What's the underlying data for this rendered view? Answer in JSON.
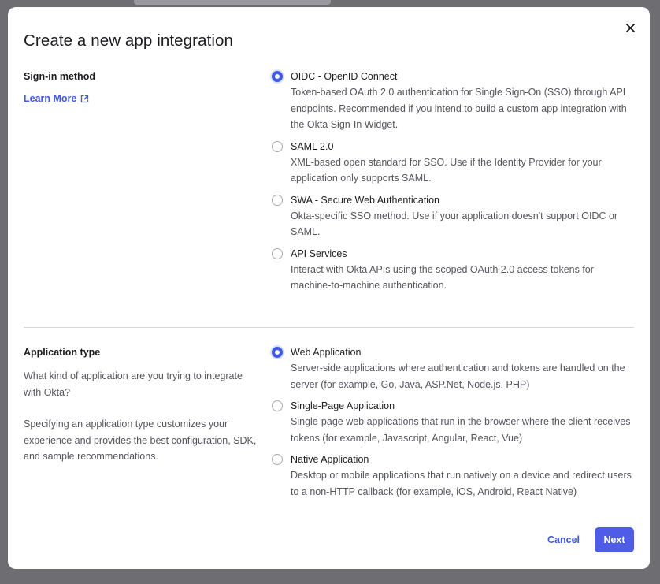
{
  "modal": {
    "title": "Create a new app integration",
    "close_icon": "close-icon"
  },
  "signin": {
    "heading": "Sign-in method",
    "learn_more": "Learn More",
    "learn_more_icon": "external-link-icon",
    "options": [
      {
        "label": "OIDC - OpenID Connect",
        "description": "Token-based OAuth 2.0 authentication for Single Sign-On (SSO) through API endpoints. Recommended if you intend to build a custom app integration with the Okta Sign-In Widget.",
        "selected": true
      },
      {
        "label": "SAML 2.0",
        "description": "XML-based open standard for SSO. Use if the Identity Provider for your application only supports SAML.",
        "selected": false
      },
      {
        "label": "SWA - Secure Web Authentication",
        "description": "Okta-specific SSO method. Use if your application doesn't support OIDC or SAML.",
        "selected": false
      },
      {
        "label": "API Services",
        "description": "Interact with Okta APIs using the scoped OAuth 2.0 access tokens for machine-to-machine authentication.",
        "selected": false
      }
    ]
  },
  "apptype": {
    "heading": "Application type",
    "desc1": "What kind of application are you trying to integrate with Okta?",
    "desc2": "Specifying an application type customizes your experience and provides the best configuration, SDK, and sample recommendations.",
    "options": [
      {
        "label": "Web Application",
        "description": "Server-side applications where authentication and tokens are handled on the server (for example, Go, Java, ASP.Net, Node.js, PHP)",
        "selected": true
      },
      {
        "label": "Single-Page Application",
        "description": "Single-page web applications that run in the browser where the client receives tokens (for example, Javascript, Angular, React, Vue)",
        "selected": false
      },
      {
        "label": "Native Application",
        "description": "Desktop or mobile applications that run natively on a device and redirect users to a non-HTTP callback (for example, iOS, Android, React Native)",
        "selected": false
      }
    ]
  },
  "footer": {
    "cancel_label": "Cancel",
    "next_label": "Next"
  },
  "colors": {
    "accent": "#3f59e4",
    "primary_button": "#4f5ce8",
    "backdrop": "#6d6d72"
  }
}
